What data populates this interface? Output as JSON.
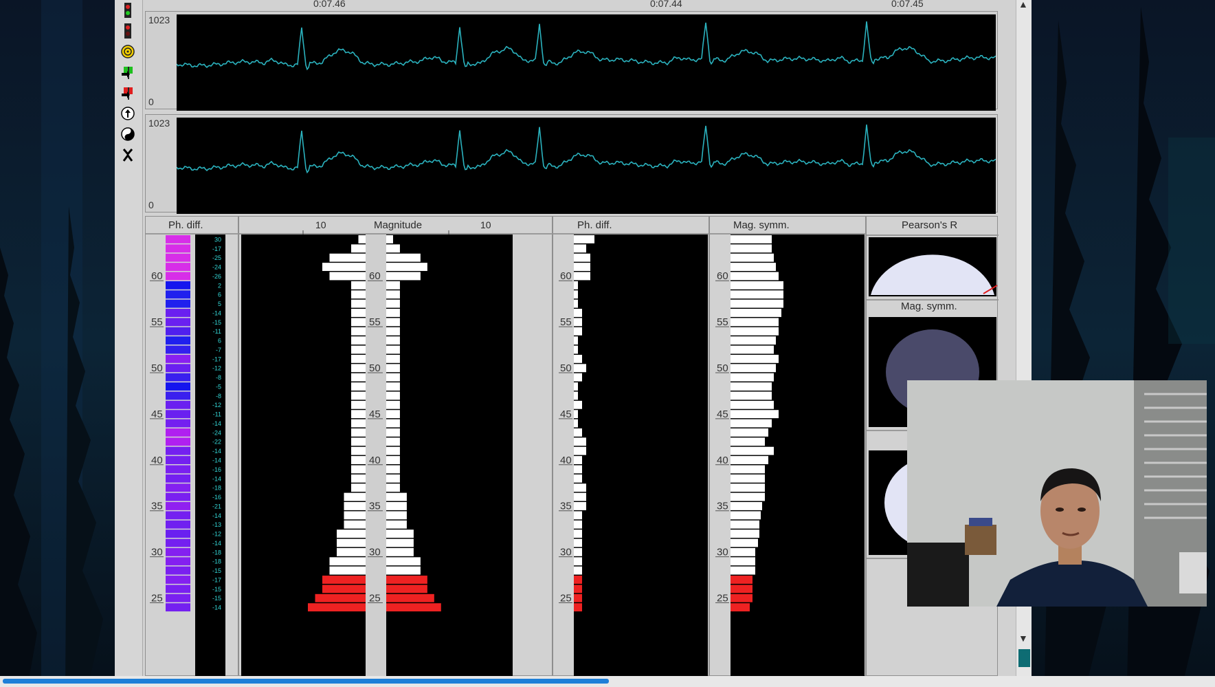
{
  "ruler": {
    "ticks": [
      "0:07.46",
      "0:07.44",
      "0:07.45"
    ]
  },
  "strips": [
    {
      "ymax": "1023",
      "ymin": "0"
    },
    {
      "ymax": "1023",
      "ymin": "0"
    }
  ],
  "toolbar": {
    "icons": [
      "traffic-light-green-icon",
      "traffic-light-red-icon",
      "spiral-icon",
      "green-flag-icon",
      "red-flag-icon",
      "up-arrow-circle-icon",
      "yin-yang-icon",
      "close-x-icon"
    ]
  },
  "panels": {
    "ph_diff": {
      "title": "Ph. diff."
    },
    "magnitude": {
      "title": "Magnitude",
      "scale_left": "10",
      "scale_right": "10"
    },
    "ph_diff2": {
      "title": "Ph. diff."
    },
    "mag_symm": {
      "title": "Mag. symm."
    },
    "pearson": {
      "title": "Pearson's R"
    },
    "mag_symm2": {
      "title": "Mag. symm."
    }
  },
  "y_labels": [
    "60",
    "55",
    "50",
    "45",
    "40",
    "35",
    "30",
    "25"
  ],
  "phase_values": [
    "30",
    "-17",
    "-25",
    "-24",
    "-26",
    "2",
    "6",
    "5",
    "-14",
    "-15",
    "-11",
    "6",
    "-7",
    "-17",
    "-12",
    "-8",
    "-5",
    "-8",
    "-12",
    "-11",
    "-14",
    "-24",
    "-22",
    "-14",
    "-14",
    "-16",
    "-14",
    "-18",
    "-16",
    "-21",
    "-14",
    "-13",
    "-12",
    "-14",
    "-18",
    "-18",
    "-15",
    "-17",
    "-15",
    "-15",
    "-14"
  ],
  "phase_colors": [
    "#d72ee8",
    "#d72ee8",
    "#d72ee8",
    "#d72ee8",
    "#d72ee8",
    "#1515ee",
    "#2020ee",
    "#2020ee",
    "#6a20f0",
    "#6a20f0",
    "#5020ee",
    "#2020ee",
    "#3320ee",
    "#8a20f0",
    "#6a20f0",
    "#3a20ee",
    "#1515ee",
    "#3a20ee",
    "#6a20f0",
    "#6a20f0",
    "#7420f0",
    "#b020f0",
    "#b020f0",
    "#7420f0",
    "#7420f0",
    "#7a20f0",
    "#7420f0",
    "#8420f0",
    "#7a20f0",
    "#9020f0",
    "#7420f0",
    "#7020f0",
    "#6a20f0",
    "#7420f0",
    "#8420f0",
    "#8420f0",
    "#7a20f0",
    "#8420f0",
    "#7a20f0",
    "#7a20f0",
    "#7420f0"
  ],
  "colors": {
    "trace": "#2bb3bf",
    "white_bar": "#ffffff",
    "red_bar": "#ee2222",
    "label_cyan": "#33d5d5",
    "accent": "#0e6c73"
  }
}
